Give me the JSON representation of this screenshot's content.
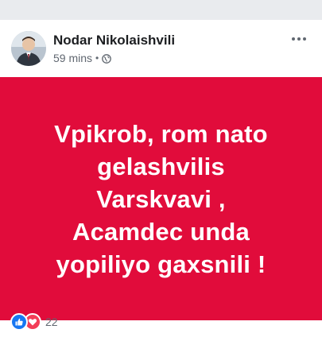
{
  "post": {
    "author": "Nodar Nikolaishvili",
    "timestamp": "59 mins",
    "separator": "•",
    "privacy_icon": "globe-icon",
    "more_icon": "more-options-icon",
    "text_lines": [
      "Vpikrob, rom nato",
      "gelashvilis",
      "Varskvavi ,",
      "Acamdec unda",
      "yopiliyo gaxsnili !"
    ],
    "background_color": "#e10c3b",
    "text_color": "#ffffff"
  },
  "reactions": {
    "icons": [
      "like-icon",
      "love-icon"
    ],
    "count": "22"
  }
}
